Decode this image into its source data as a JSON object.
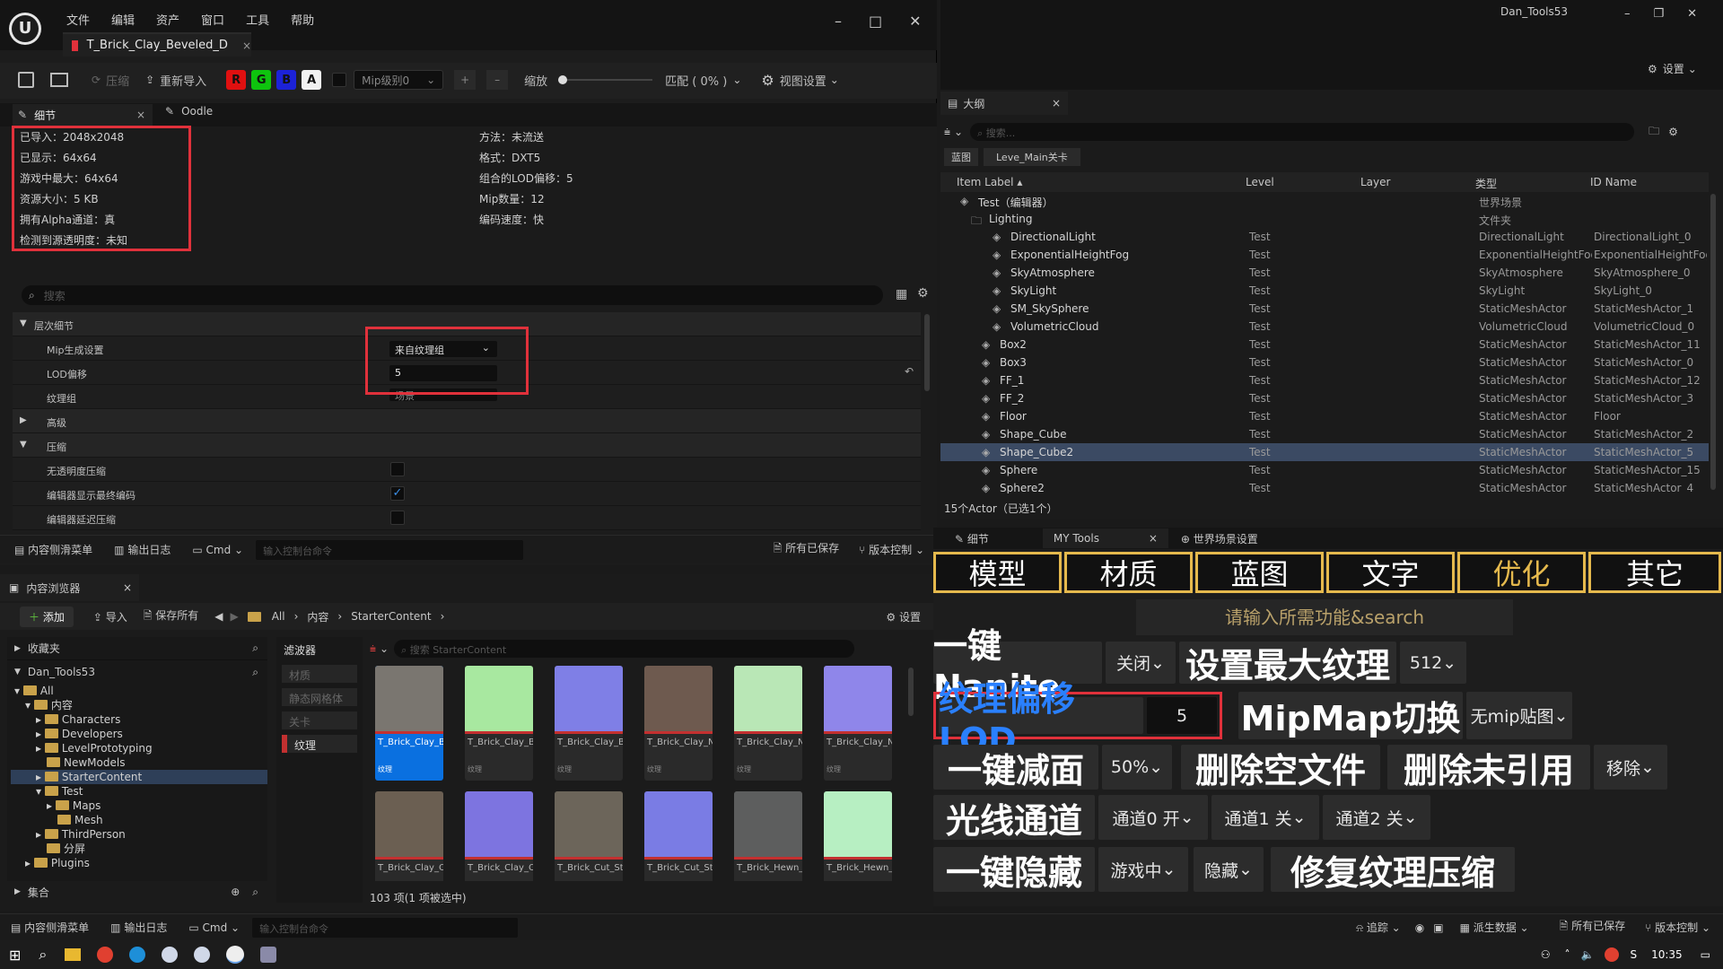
{
  "window": {
    "right_title": "Dan_Tools53",
    "right_settings": "设置"
  },
  "menu": [
    "文件",
    "编辑",
    "资产",
    "窗口",
    "工具",
    "帮助"
  ],
  "texture_tab": "T_Brick_Clay_Beveled_D",
  "toolbar": {
    "compress": "压缩",
    "reimport": "重新导入",
    "channels": [
      "R",
      "G",
      "B",
      "A"
    ],
    "mip_level": "Mip级别0",
    "zoom_label": "缩放",
    "fit_label": "匹配 ( 0% )",
    "view_settings": "视图设置"
  },
  "detail_tabs": {
    "details": "细节",
    "oodle": "Oodle"
  },
  "info_left": [
    "已导入：2048x2048",
    "已显示：64x64",
    "游戏中最大：64x64",
    "资源大小：5 KB",
    "拥有Alpha通道：真",
    "检测到源透明度：未知"
  ],
  "info_right": [
    "方法：未流送",
    "格式：DXT5",
    "组合的LOD偏移：5",
    "Mip数量：12",
    "编码速度：快"
  ],
  "search_placeholder": "搜索",
  "props": {
    "lod_section": "层次细节",
    "mip_gen": "Mip生成设置",
    "mip_gen_value": "来自纹理组",
    "lod_bias": "LOD偏移",
    "lod_bias_value": "5",
    "texture_group": "纹理组",
    "texture_group_value": "场景",
    "advanced": "高级",
    "compression": "压缩",
    "no_alpha": "无透明度压缩",
    "show_final": "编辑器显示最终编码",
    "defer_comp": "编辑器延迟压缩"
  },
  "statusbar": {
    "content_drawer": "内容侧滑菜单",
    "output_log": "输出日志",
    "cmd": "Cmd",
    "console_placeholder": "输入控制台命令",
    "all_saved": "所有已保存",
    "source_control": "版本控制"
  },
  "content_browser": {
    "tab": "内容浏览器",
    "add": "添加",
    "import": "导入",
    "save_all": "保存所有",
    "crumbs": [
      "All",
      "内容",
      "StarterContent"
    ],
    "settings": "设置",
    "favorites": "收藏夹",
    "project": "Dan_Tools53",
    "filters": "滤波器",
    "filter_items": [
      "材质",
      "静态网格体",
      "关卡",
      "纹理"
    ],
    "search_placeholder": "搜索 StarterContent",
    "tree": [
      "All",
      "内容",
      "Characters",
      "Developers",
      "LevelPrototyping",
      "NewModels",
      "StarterContent",
      "Test",
      "Maps",
      "Mesh",
      "ThirdPerson",
      "分屏",
      "Plugins"
    ],
    "collections": "集合",
    "count": "103 项(1 项被选中)",
    "assets": [
      {
        "name": "T_Brick_Clay_Beveled_D",
        "type": "纹理",
        "color": "#7a7670"
      },
      {
        "name": "T_Brick_Clay_Beveled_M",
        "type": "纹理",
        "color": "#a8e8a0"
      },
      {
        "name": "T_Brick_Clay_Beveled_N",
        "type": "纹理",
        "color": "#7f7fe6"
      },
      {
        "name": "T_Brick_Clay_New_D",
        "type": "纹理",
        "color": "#6e5a4f"
      },
      {
        "name": "T_Brick_Clay_New_M",
        "type": "纹理",
        "color": "#b9e7b6"
      },
      {
        "name": "T_Brick_Clay_New_N",
        "type": "纹理",
        "color": "#8f86ea"
      },
      {
        "name": "T_Brick_Clay_Old_D",
        "type": "",
        "color": "#6b5f52"
      },
      {
        "name": "T_Brick_Clay_Old_N",
        "type": "",
        "color": "#7d74e0"
      },
      {
        "name": "T_Brick_Cut_Stone_D",
        "type": "",
        "color": "#6c655a"
      },
      {
        "name": "T_Brick_Cut_Stone_N",
        "type": "",
        "color": "#7a7ce4"
      },
      {
        "name": "T_Brick_Hewn_Stone_D",
        "type": "",
        "color": "#5d5e5e"
      },
      {
        "name": "T_Brick_Hewn_Stone_M",
        "type": "",
        "color": "#b7efc2"
      }
    ]
  },
  "outliner": {
    "tab": "大纲",
    "search_placeholder": "搜索...",
    "filter_tags": [
      "蓝图",
      "Leve_Main关卡"
    ],
    "cols": [
      "Item Label",
      "Level",
      "Layer",
      "类型",
      "ID Name"
    ],
    "rows": [
      {
        "label": "Test（编辑器）",
        "level": "",
        "type": "世界场景",
        "id": ""
      },
      {
        "label": "Lighting",
        "level": "",
        "type": "文件夹",
        "id": ""
      },
      {
        "label": "DirectionalLight",
        "level": "Test",
        "type": "DirectionalLight",
        "id": "DirectionalLight_0"
      },
      {
        "label": "ExponentialHeightFog",
        "level": "Test",
        "type": "ExponentialHeightFog",
        "id": "ExponentialHeightFog"
      },
      {
        "label": "SkyAtmosphere",
        "level": "Test",
        "type": "SkyAtmosphere",
        "id": "SkyAtmosphere_0"
      },
      {
        "label": "SkyLight",
        "level": "Test",
        "type": "SkyLight",
        "id": "SkyLight_0"
      },
      {
        "label": "SM_SkySphere",
        "level": "Test",
        "type": "StaticMeshActor",
        "id": "StaticMeshActor_1"
      },
      {
        "label": "VolumetricCloud",
        "level": "Test",
        "type": "VolumetricCloud",
        "id": "VolumetricCloud_0"
      },
      {
        "label": "Box2",
        "level": "Test",
        "type": "StaticMeshActor",
        "id": "StaticMeshActor_11"
      },
      {
        "label": "Box3",
        "level": "Test",
        "type": "StaticMeshActor",
        "id": "StaticMeshActor_0"
      },
      {
        "label": "FF_1",
        "level": "Test",
        "type": "StaticMeshActor",
        "id": "StaticMeshActor_12"
      },
      {
        "label": "FF_2",
        "level": "Test",
        "type": "StaticMeshActor",
        "id": "StaticMeshActor_3"
      },
      {
        "label": "Floor",
        "level": "Test",
        "type": "StaticMeshActor",
        "id": "Floor"
      },
      {
        "label": "Shape_Cube",
        "level": "Test",
        "type": "StaticMeshActor",
        "id": "StaticMeshActor_2"
      },
      {
        "label": "Shape_Cube2",
        "level": "Test",
        "type": "StaticMeshActor",
        "id": "StaticMeshActor_5"
      },
      {
        "label": "Sphere",
        "level": "Test",
        "type": "StaticMeshActor",
        "id": "StaticMeshActor_15"
      },
      {
        "label": "Sphere2",
        "level": "Test",
        "type": "StaticMeshActor",
        "id": "StaticMeshActor_4"
      }
    ],
    "footer": "15个Actor（已选1个）"
  },
  "tools_tabs": {
    "details": "细节",
    "my_tools": "MY Tools",
    "world_settings": "世界场景设置"
  },
  "tools": {
    "categories": [
      "模型",
      "材质",
      "蓝图",
      "文字",
      "优化",
      "其它"
    ],
    "search_placeholder": "请输入所需功能&search",
    "nanite": "一键Nanite",
    "nanite_opt": "关闭",
    "max_tex": "设置最大纹理",
    "max_tex_opt": "512",
    "lod_offset": "纹理偏移LOD",
    "lod_offset_val": "5",
    "mip_switch": "MipMap切换",
    "mip_opt": "无mip贴图",
    "reduce": "一键减面",
    "reduce_opt": "50%",
    "del_empty": "删除空文件",
    "del_unref": "删除未引用",
    "remove_opt": "移除",
    "light_channel": "光线通道",
    "ch0": "通道0 开",
    "ch1": "通道1 关",
    "ch2": "通道2 关",
    "hide": "一键隐藏",
    "hide_opt1": "游戏中",
    "hide_opt2": "隐藏",
    "fix_tex": "修复纹理压缩"
  },
  "bottom_bar": {
    "content_drawer": "内容侧滑菜单",
    "output_log": "输出日志",
    "cmd": "Cmd",
    "console_placeholder": "输入控制台命令",
    "trace": "追踪",
    "derived": "派生数据",
    "all_saved": "所有已保存",
    "source_control": "版本控制"
  },
  "taskbar": {
    "time": "10:35"
  }
}
